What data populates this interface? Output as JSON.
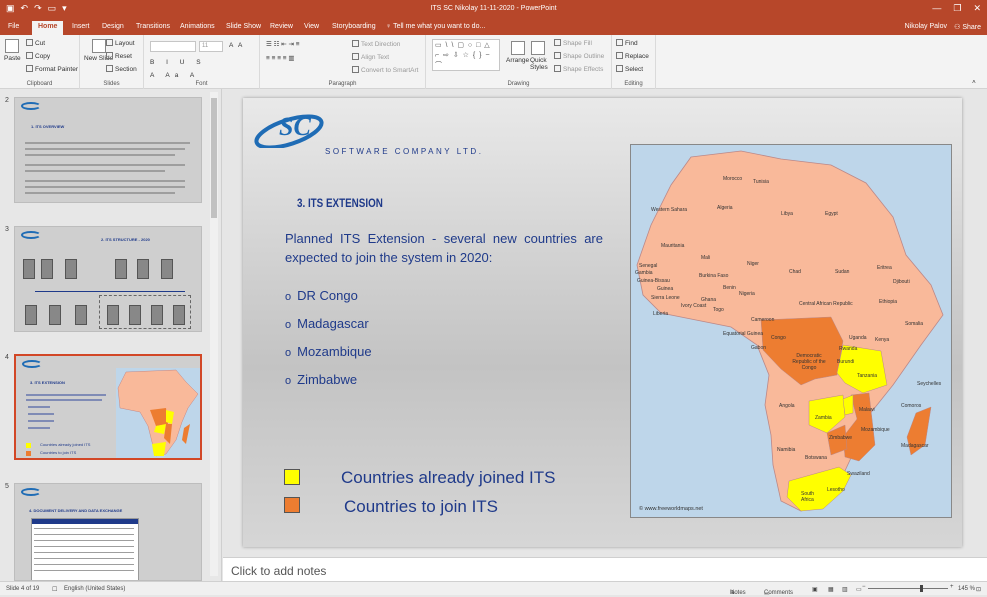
{
  "window": {
    "title": "ITS SC Nikolay 11-11-2020 - PowerPoint",
    "user": "Nikolay Palov",
    "share": "Share",
    "controls": [
      "—",
      "❐",
      "✕"
    ]
  },
  "tabs": [
    "File",
    "Home",
    "Insert",
    "Design",
    "Transitions",
    "Animations",
    "Slide Show",
    "Review",
    "View",
    "Storyboarding"
  ],
  "active_tab": "Home",
  "tell_me": "Tell me what you want to do...",
  "ribbon": {
    "clipboard": {
      "label": "Clipboard",
      "paste": "Paste",
      "cut": "Cut",
      "copy": "Copy",
      "format_painter": "Format Painter"
    },
    "slides": {
      "label": "Slides",
      "new_slide": "New Slide",
      "layout": "Layout",
      "reset": "Reset",
      "section": "Section"
    },
    "font": {
      "label": "Font",
      "size": "11"
    },
    "paragraph": {
      "label": "Paragraph",
      "text_direction": "Text Direction",
      "align_text": "Align Text",
      "smartart": "Convert to SmartArt"
    },
    "drawing": {
      "label": "Drawing",
      "arrange": "Arrange",
      "quick_styles": "Quick Styles",
      "shape_fill": "Shape Fill",
      "shape_outline": "Shape Outline",
      "shape_effects": "Shape Effects"
    },
    "editing": {
      "label": "Editing",
      "find": "Find",
      "replace": "Replace",
      "select": "Select"
    }
  },
  "thumbnails": [
    {
      "num": "2",
      "caption": "1. ITS OVERVIEW"
    },
    {
      "num": "3",
      "caption": "2. ITS STRUCTURE - 2020"
    },
    {
      "num": "4",
      "caption": "3. ITS EXTENSION",
      "legend_a": "Countries already joined ITS",
      "legend_b": "Countries to join ITS"
    },
    {
      "num": "5",
      "caption": "4. DOCUMENT DELIVERY AND DATA EXCHANGE"
    }
  ],
  "slide": {
    "company": "SOFTWARE COMPANY LTD.",
    "logo_text": "SC",
    "title": "3. ITS EXTENSION",
    "description": "Planned ITS Extension - several new countries are expected to join the system in 2020:",
    "bullets": [
      "DR Congo",
      "Madagascar",
      "Mozambique",
      "Zimbabwe"
    ],
    "legend": [
      {
        "label": "Countries already joined ITS",
        "color": "#ffff00"
      },
      {
        "label": "Countries to join ITS",
        "color": "#ed7d31"
      }
    ],
    "map": {
      "credit": "© www.freeworldmaps.net",
      "countries": [
        "Morocco",
        "Tunisia",
        "Algeria",
        "Libya",
        "Egypt",
        "Western Sahara",
        "Mauritania",
        "Mali",
        "Niger",
        "Chad",
        "Sudan",
        "Eritrea",
        "Senegal",
        "Gambia",
        "Guinea-Bissau",
        "Guinea",
        "Sierra Leone",
        "Liberia",
        "Burkina Faso",
        "Ghana",
        "Ivory Coast",
        "Togo",
        "Benin",
        "Nigeria",
        "Djibouti",
        "Ethiopia",
        "Somalia",
        "Cameroon",
        "Central African Republic",
        "Equatorial Guinea",
        "Gabon",
        "Congo",
        "Democratic Republic of the Congo",
        "Uganda",
        "Kenya",
        "Rwanda",
        "Burundi",
        "Tanzania",
        "Seychelles",
        "Angola",
        "Zambia",
        "Malawi",
        "Comoros",
        "Mozambique",
        "Madagascar",
        "Zimbabwe",
        "Namibia",
        "Botswana",
        "Swaziland",
        "Lesotho",
        "South Africa"
      ]
    }
  },
  "notes_placeholder": "Click to add notes",
  "status": {
    "slide": "Slide 4 of 19",
    "language": "English (United States)",
    "notes": "Notes",
    "comments": "Comments",
    "zoom": "145 %"
  },
  "colors": {
    "accent": "#b7472a",
    "title_blue": "#1f3a8a",
    "land": "#f9b99a",
    "joined": "#ffff00",
    "to_join": "#ed7d31",
    "sea": "#bed6ea"
  }
}
